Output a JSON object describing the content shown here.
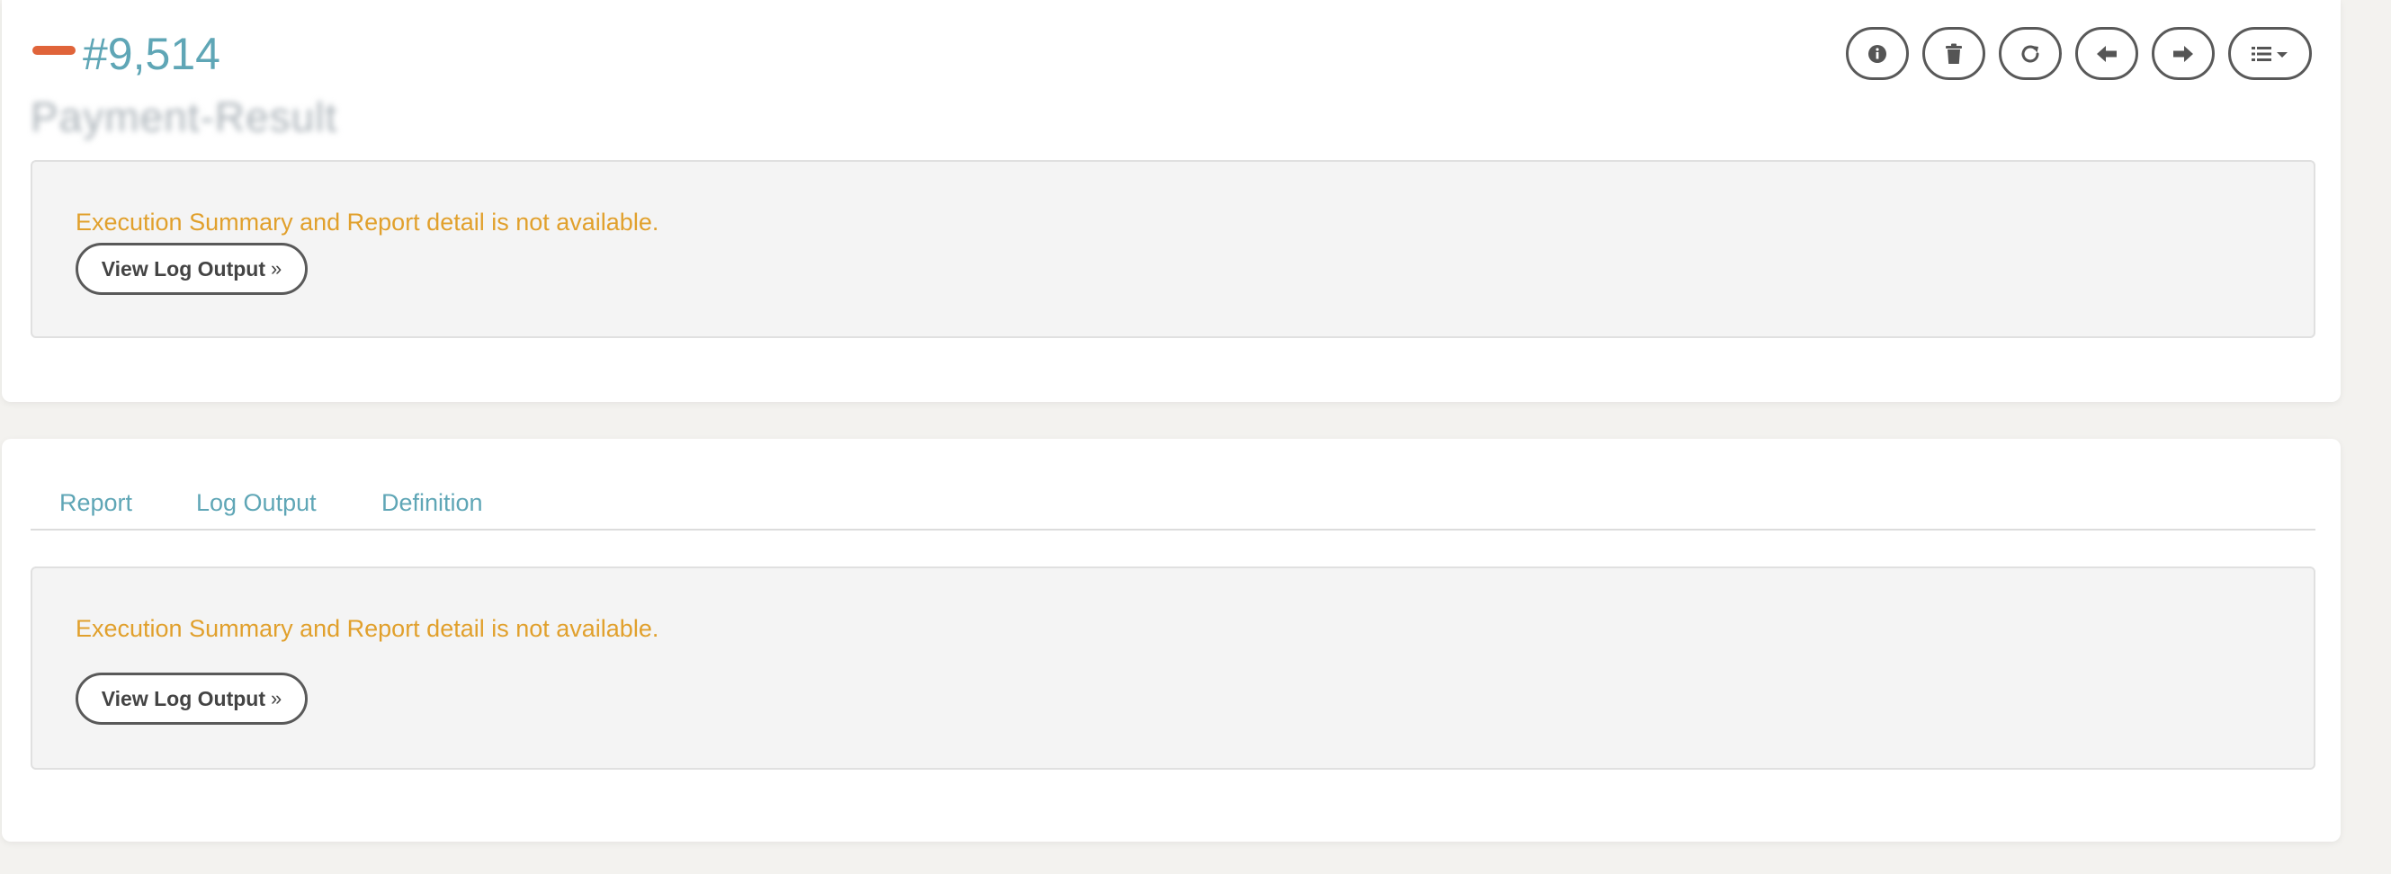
{
  "header": {
    "execution_id": "#9,514",
    "job_name": "Payment-Result",
    "status_color": "#e0643a"
  },
  "toolbar": {
    "icons": [
      "info-icon",
      "trash-icon",
      "refresh-icon",
      "arrow-left-icon",
      "arrow-right-icon",
      "list-menu-icon"
    ]
  },
  "summary": {
    "message": "Execution Summary and Report detail is not available.",
    "button_label": "View Log Output",
    "button_suffix": "»"
  },
  "tabs": [
    {
      "label": "Report"
    },
    {
      "label": "Log Output"
    },
    {
      "label": "Definition"
    }
  ],
  "report_panel": {
    "message": "Execution Summary and Report detail is not available.",
    "button_label": "View Log Output",
    "button_suffix": "»"
  },
  "colors": {
    "accent": "#5fa6b6",
    "warning": "#e1a02c",
    "status": "#e0643a"
  }
}
